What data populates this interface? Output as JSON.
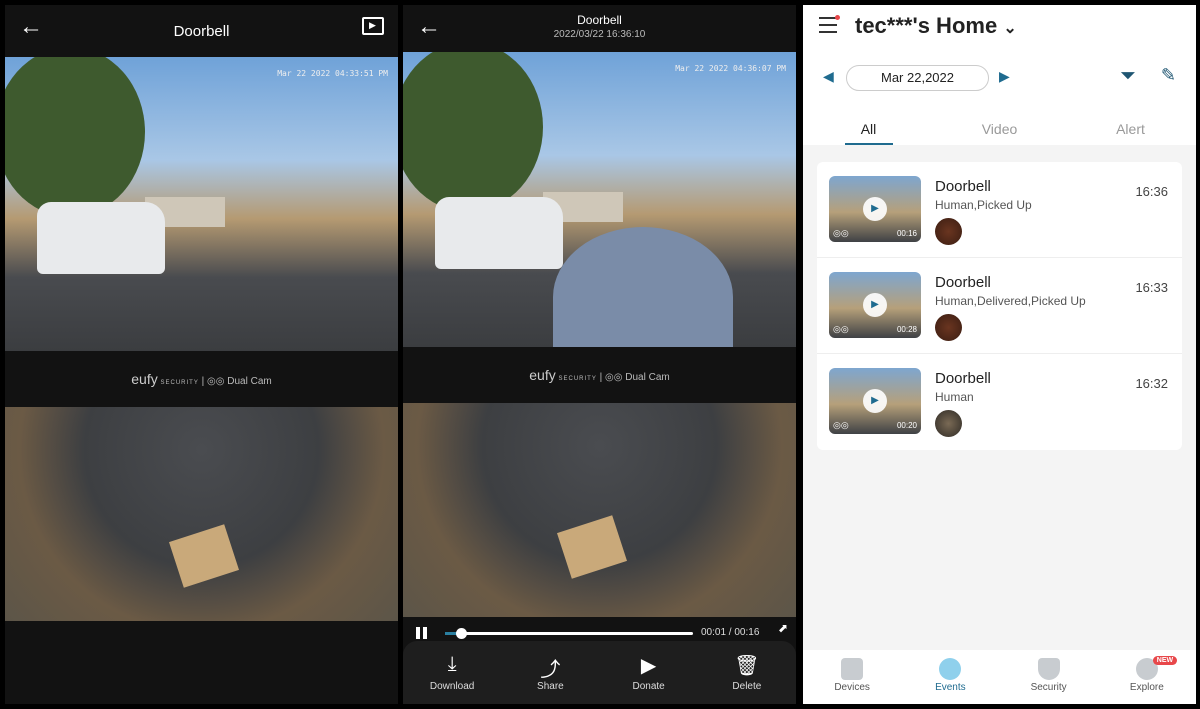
{
  "panel1": {
    "title": "Doorbell",
    "timestamp_overlay": "Mar 22 2022  04:33:51 PM",
    "brand": {
      "logo": "eufy",
      "security": "SECURITY",
      "divider": "|",
      "dual_icon": "◎◎",
      "dual_cam": "Dual Cam"
    }
  },
  "panel2": {
    "title": "Doorbell",
    "subtitle": "2022/03/22 16:36:10",
    "timestamp_overlay": "Mar 22 2022  04:36:07 PM",
    "brand": {
      "logo": "eufy",
      "security": "SECURITY",
      "divider": "|",
      "dual_icon": "◎◎",
      "dual_cam": "Dual Cam"
    },
    "player": {
      "time": "00:01 / 00:16",
      "progress": 0.0625
    },
    "actions": [
      {
        "label": "Download",
        "icon": "⤓"
      },
      {
        "label": "Share",
        "icon": "⤴"
      },
      {
        "label": "Donate",
        "icon": "▶"
      },
      {
        "label": "Delete",
        "icon": "🗑"
      }
    ]
  },
  "panel3": {
    "home_title": "tec***'s Home",
    "dropdown_icon": "⌄",
    "date": "Mar 22,2022",
    "prev_icon": "◀",
    "next_icon": "▶",
    "filter_icon": "⏷",
    "edit_icon": "✎",
    "tabs": [
      {
        "label": "All"
      },
      {
        "label": "Video"
      },
      {
        "label": "Alert"
      }
    ],
    "events": [
      {
        "name": "Doorbell",
        "tags": "Human,Picked Up",
        "time": "16:36",
        "duration": "00:16"
      },
      {
        "name": "Doorbell",
        "tags": "Human,Delivered,Picked Up",
        "time": "16:33",
        "duration": "00:28"
      },
      {
        "name": "Doorbell",
        "tags": "Human",
        "time": "16:32",
        "duration": "00:20"
      }
    ],
    "nav": [
      {
        "label": "Devices"
      },
      {
        "label": "Events"
      },
      {
        "label": "Security"
      },
      {
        "label": "Explore",
        "badge": "NEW"
      }
    ],
    "accent": "#1f6b8f"
  },
  "common": {
    "back_icon": "←",
    "play_icon": "▶",
    "expand_icon": "⬈",
    "dual_cam_icon": "◎◎"
  }
}
